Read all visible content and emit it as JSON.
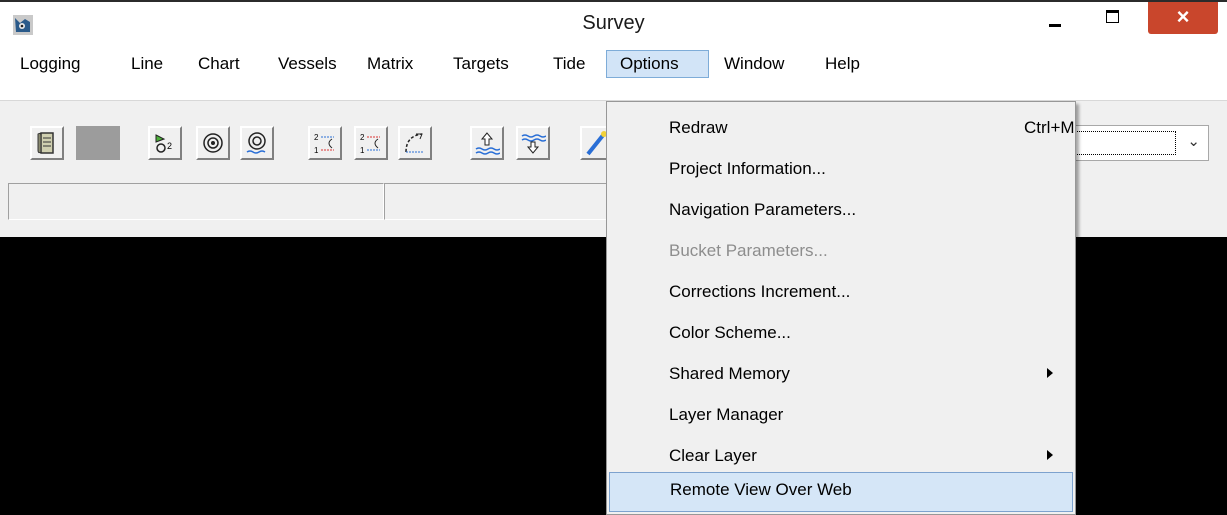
{
  "window": {
    "title": "Survey",
    "close_glyph": "×"
  },
  "menubar": {
    "items": [
      {
        "label": "Logging"
      },
      {
        "label": "Line"
      },
      {
        "label": "Chart"
      },
      {
        "label": "Vessels"
      },
      {
        "label": "Matrix"
      },
      {
        "label": "Targets"
      },
      {
        "label": "Tide"
      },
      {
        "label": "Options",
        "active": true
      },
      {
        "label": "Window"
      },
      {
        "label": "Help"
      }
    ]
  },
  "toolbar": {
    "combo_value": "",
    "combo_arrow": "⌄"
  },
  "options_menu": {
    "items": [
      {
        "label": "Redraw",
        "shortcut": "Ctrl+M"
      },
      {
        "label": "Project Information..."
      },
      {
        "label": "Navigation Parameters..."
      },
      {
        "label": "Bucket Parameters...",
        "disabled": true
      },
      {
        "label": "Corrections Increment..."
      },
      {
        "label": "Color Scheme..."
      },
      {
        "label": "Shared Memory",
        "submenu": true
      },
      {
        "label": "Layer Manager"
      },
      {
        "label": "Clear Layer",
        "submenu": true
      },
      {
        "label": "Remote View Over Web",
        "highlighted": true
      }
    ]
  },
  "colors": {
    "close_button": "#c9462c",
    "menu_highlight": "#d5e6f7",
    "canvas": "#000000"
  }
}
